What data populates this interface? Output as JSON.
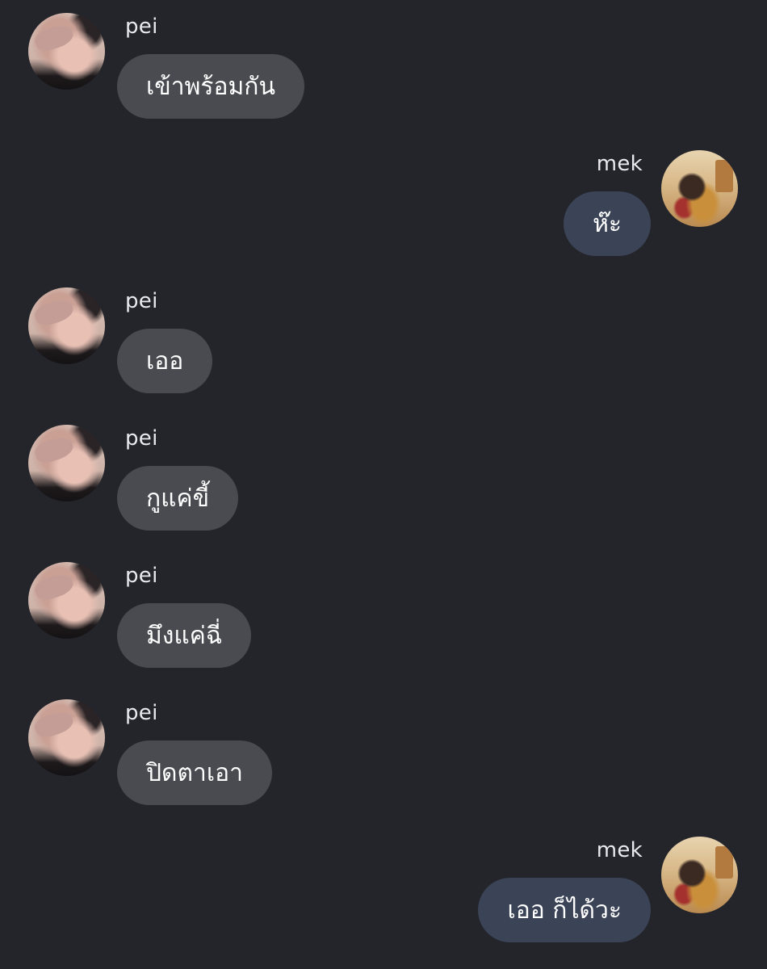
{
  "messages": [
    {
      "sender": "pei",
      "text": "เข้าพร้อมกัน",
      "side": "left"
    },
    {
      "sender": "mek",
      "text": "ห๊ะ",
      "side": "right"
    },
    {
      "sender": "pei",
      "text": "เออ",
      "side": "left"
    },
    {
      "sender": "pei",
      "text": "กูแค่ขี้",
      "side": "left"
    },
    {
      "sender": "pei",
      "text": "มึงแค่ฉี่",
      "side": "left"
    },
    {
      "sender": "pei",
      "text": "ปิดตาเอา",
      "side": "left"
    },
    {
      "sender": "mek",
      "text": "เออ ก็ได้วะ",
      "side": "right"
    }
  ],
  "colors": {
    "background": "#24252b",
    "left_bubble": "#4a4b51",
    "right_bubble": "#3b4356",
    "text": "#ffffff"
  }
}
